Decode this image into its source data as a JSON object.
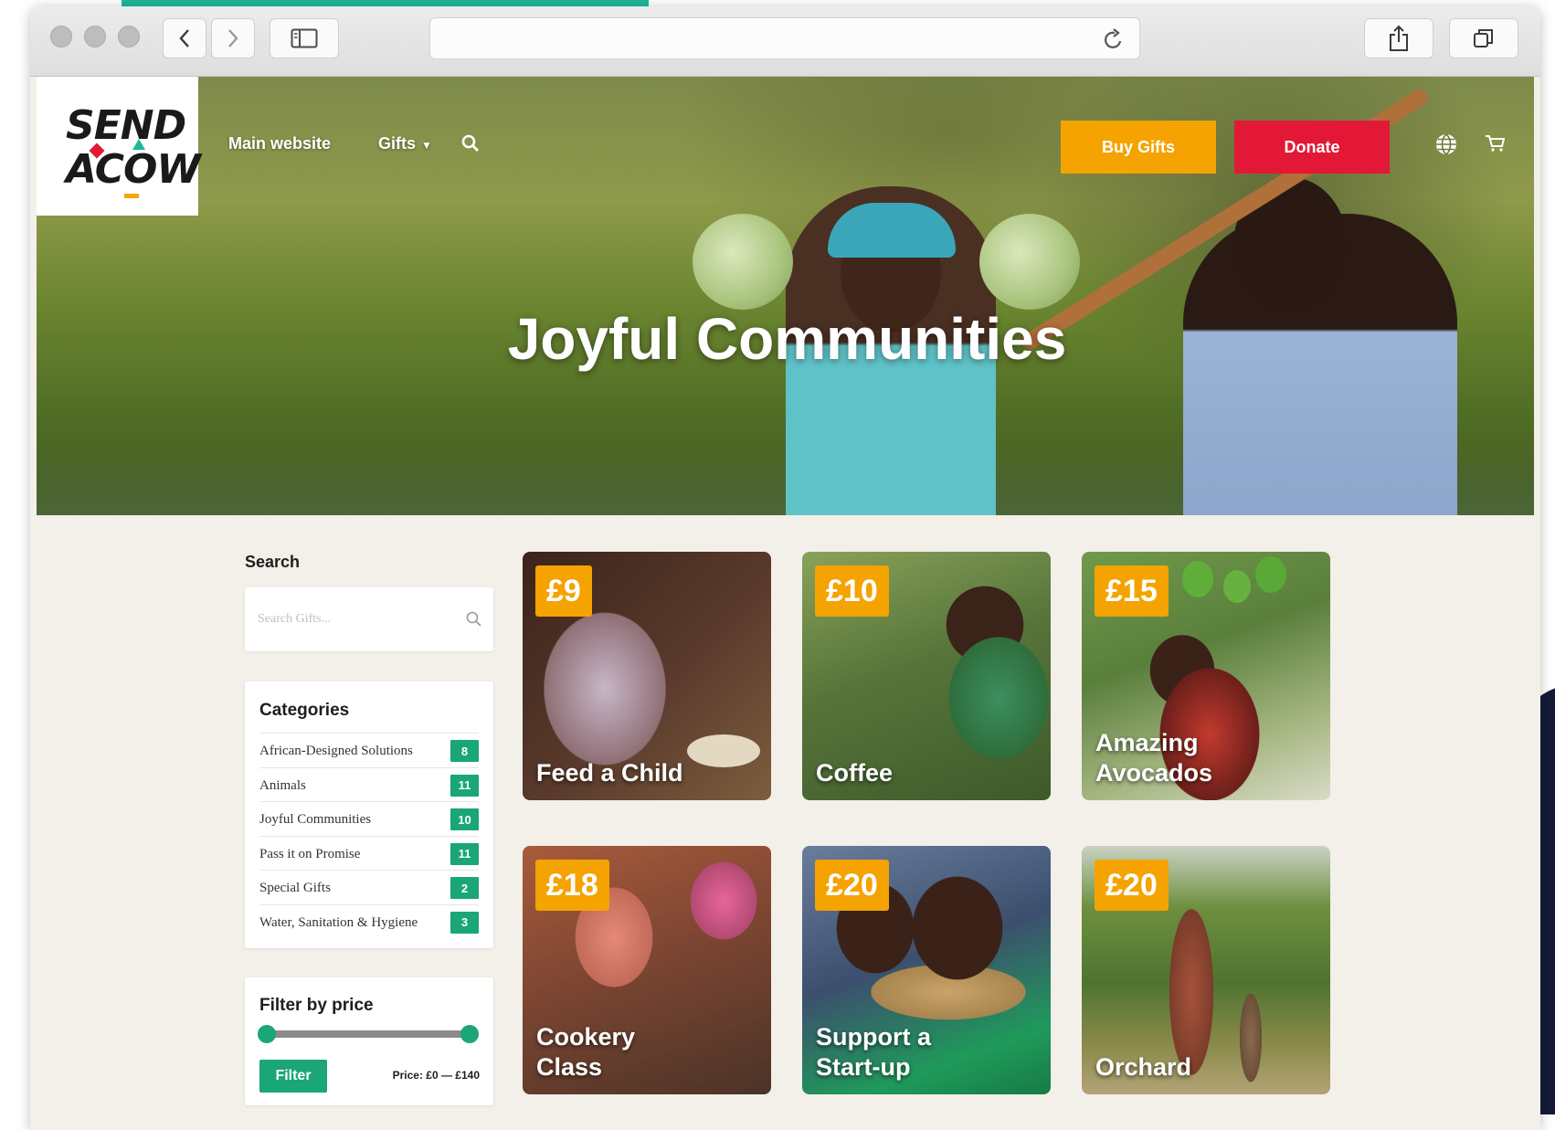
{
  "browser": {
    "url": ""
  },
  "site": {
    "logo_line1": "SEND",
    "logo_line2": "ACOW",
    "nav": {
      "main_website": "Main website",
      "gifts": "Gifts"
    },
    "buy_gifts": "Buy Gifts",
    "donate": "Donate"
  },
  "hero": {
    "title": "Joyful Communities"
  },
  "sidebar": {
    "search_label": "Search",
    "search_placeholder": "Search Gifts...",
    "categories_title": "Categories",
    "categories": [
      {
        "name": "African-Designed Solutions",
        "count": "8"
      },
      {
        "name": "Animals",
        "count": "11"
      },
      {
        "name": "Joyful Communities",
        "count": "10"
      },
      {
        "name": "Pass it on Promise",
        "count": "11"
      },
      {
        "name": "Special Gifts",
        "count": "2"
      },
      {
        "name": "Water, Sanitation & Hygiene",
        "count": "3"
      }
    ],
    "filter": {
      "title": "Filter by price",
      "button": "Filter",
      "price_text": "Price: £0 — £140",
      "range_min": 0,
      "range_max": 140
    }
  },
  "gifts": [
    {
      "price": "£9",
      "name": "Feed a Child"
    },
    {
      "price": "£10",
      "name": "Coffee"
    },
    {
      "price": "£15",
      "name": "Amazing\nAvocados"
    },
    {
      "price": "£18",
      "name": "Cookery\nClass"
    },
    {
      "price": "£20",
      "name": "Support a\nStart-up"
    },
    {
      "price": "£20",
      "name": "Orchard"
    }
  ],
  "colors": {
    "accent_orange": "#f4a300",
    "donate_red": "#e31837",
    "category_green": "#1aa675",
    "page_bg": "#f3efe9"
  }
}
